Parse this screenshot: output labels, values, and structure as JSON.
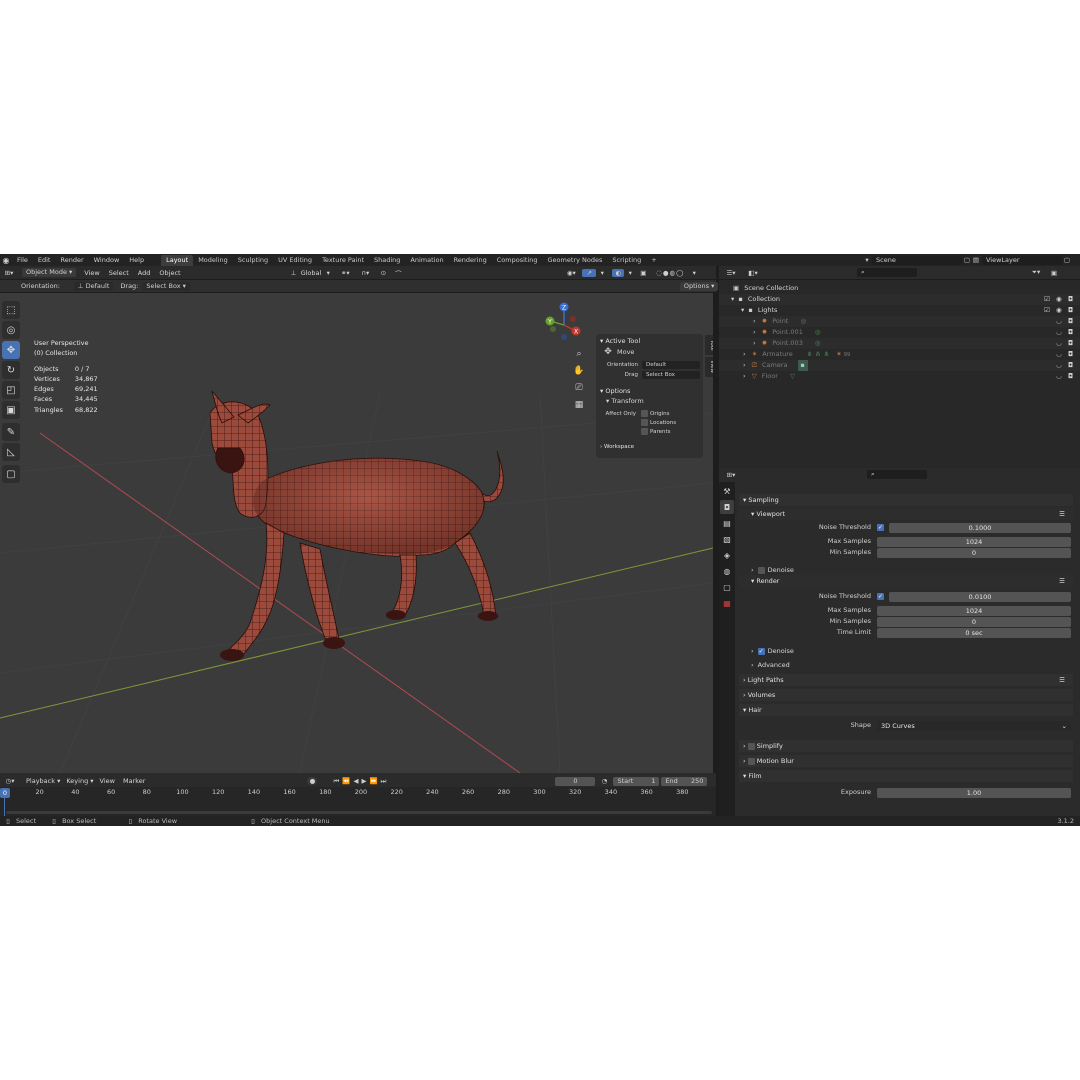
{
  "menu": {
    "items": [
      "File",
      "Edit",
      "Render",
      "Window",
      "Help"
    ],
    "workspaces": [
      {
        "label": "Layout",
        "active": true
      },
      {
        "label": "Modeling"
      },
      {
        "label": "Sculpting"
      },
      {
        "label": "UV Editing"
      },
      {
        "label": "Texture Paint"
      },
      {
        "label": "Shading"
      },
      {
        "label": "Animation"
      },
      {
        "label": "Rendering"
      },
      {
        "label": "Compositing"
      },
      {
        "label": "Geometry Nodes"
      },
      {
        "label": "Scripting"
      }
    ],
    "add_tab": "+",
    "scene": "Scene",
    "view_layer": "ViewLayer"
  },
  "viewport_header": {
    "mode": "Object Mode",
    "menus": [
      "View",
      "Select",
      "Add",
      "Object"
    ],
    "orientation_label": "Global"
  },
  "tool_header": {
    "orientation_label": "Orientation:",
    "orientation_value": "Default",
    "drag_label": "Drag:",
    "drag_value": "Select Box",
    "options_label": "Options"
  },
  "viewport": {
    "view_name": "User Perspective",
    "collection": "(0) Collection",
    "stats": [
      {
        "label": "Objects",
        "value": "0 / 7"
      },
      {
        "label": "Vertices",
        "value": "34,867"
      },
      {
        "label": "Edges",
        "value": "69,241"
      },
      {
        "label": "Faces",
        "value": "34,445"
      },
      {
        "label": "Triangles",
        "value": "68,822"
      }
    ],
    "gizmo": {
      "x": "X",
      "y": "Y",
      "z": "Z"
    }
  },
  "npanel": {
    "active_tool_title": "Active Tool",
    "tool_name": "Move",
    "orientation_label": "Orientation",
    "orientation_value": "Default",
    "drag_label": "Drag",
    "drag_value": "Select Box",
    "options_title": "Options",
    "transform_title": "Transform",
    "affect_only_label": "Affect Only",
    "affect_items": [
      "Origins",
      "Locations",
      "Parents"
    ],
    "workspace_title": "Workspace",
    "tabs": [
      "Tool",
      "View"
    ]
  },
  "outliner": {
    "rows": [
      {
        "label": "Scene Collection",
        "indent": 0,
        "icon": "scene-collection-icon"
      },
      {
        "label": "Collection",
        "indent": 1,
        "icon": "collection-icon"
      },
      {
        "label": "Lights",
        "indent": 2,
        "icon": "collection-icon"
      },
      {
        "label": "Point",
        "indent": 3,
        "icon": "light-icon"
      },
      {
        "label": "Point.001",
        "indent": 3,
        "icon": "light-icon"
      },
      {
        "label": "Point.003",
        "indent": 3,
        "icon": "light-icon"
      },
      {
        "label": "Armature",
        "indent": 2,
        "icon": "armature-icon"
      },
      {
        "label": "Camera",
        "indent": 2,
        "icon": "camera-icon"
      },
      {
        "label": "Floor",
        "indent": 2,
        "icon": "mesh-icon"
      }
    ],
    "armature_extra": "99"
  },
  "properties": {
    "sampling": "Sampling",
    "viewport": "Viewport",
    "noise_threshold_label": "Noise Threshold",
    "viewport_noise_threshold": "0.1000",
    "max_samples_label": "Max Samples",
    "viewport_max_samples": "1024",
    "min_samples_label": "Min Samples",
    "viewport_min_samples": "0",
    "denoise_label": "Denoise",
    "render": "Render",
    "render_noise_threshold": "0.0100",
    "render_max_samples": "1024",
    "render_min_samples": "0",
    "time_limit_label": "Time Limit",
    "time_limit": "0 sec",
    "render_denoise_label": "Denoise",
    "advanced": "Advanced",
    "light_paths": "Light Paths",
    "volumes": "Volumes",
    "hair": "Hair",
    "shape_label": "Shape",
    "shape_value": "3D Curves",
    "simplify": "Simplify",
    "motion_blur": "Motion Blur",
    "film": "Film",
    "exposure_label": "Exposure",
    "exposure_value": "1.00"
  },
  "timeline": {
    "menus": [
      "Playback",
      "Keying",
      "View",
      "Marker"
    ],
    "current_frame": "0",
    "start_label": "Start",
    "start_value": "1",
    "end_label": "End",
    "end_value": "250",
    "ticks": [
      "0",
      "20",
      "40",
      "60",
      "80",
      "100",
      "120",
      "140",
      "160",
      "180",
      "200",
      "220",
      "240",
      "260",
      "280",
      "300",
      "320",
      "340",
      "360",
      "380"
    ]
  },
  "statusbar": {
    "select": "Select",
    "box_select": "Box Select",
    "rotate_view": "Rotate View",
    "context_menu": "Object Context Menu",
    "version": "3.1.2"
  }
}
